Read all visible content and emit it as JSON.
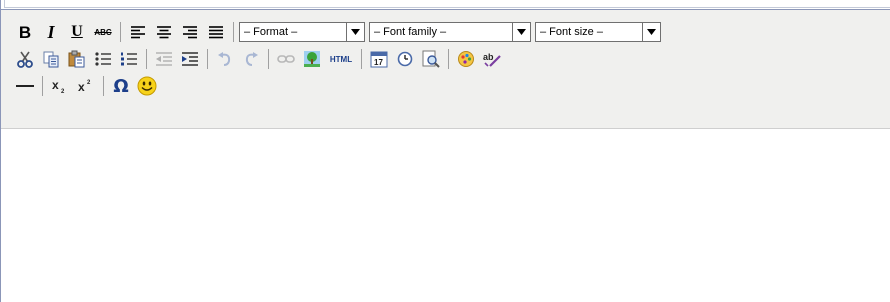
{
  "toolbar": {
    "row1": {
      "bold_label": "B",
      "italic_label": "I",
      "underline_label": "U",
      "strike_label": "ABC",
      "format_select": "– Format –",
      "font_family_select": "– Font family –",
      "font_size_select": "– Font size –"
    },
    "row2": {
      "html_label": "HTML"
    },
    "row3": {
      "omega_label": "Ω"
    }
  },
  "icons": [
    "bold-icon",
    "italic-icon",
    "underline-icon",
    "strikethrough-icon",
    "align-left-icon",
    "align-center-icon",
    "align-right-icon",
    "align-justify-icon",
    "cut-icon",
    "copy-icon",
    "paste-icon",
    "bullet-list-icon",
    "numbered-list-icon",
    "outdent-icon",
    "indent-icon",
    "undo-icon",
    "redo-icon",
    "link-icon",
    "image-icon",
    "html-icon",
    "insert-date-icon",
    "insert-time-icon",
    "preview-icon",
    "color-icon",
    "spellcheck-icon",
    "horizontal-rule-icon",
    "subscript-icon",
    "superscript-icon",
    "special-char-icon",
    "emoticon-icon"
  ],
  "colors": {
    "toolbar_bg": "#f0f0ee",
    "border": "#8b96b8",
    "separator": "#a0a0a0"
  }
}
